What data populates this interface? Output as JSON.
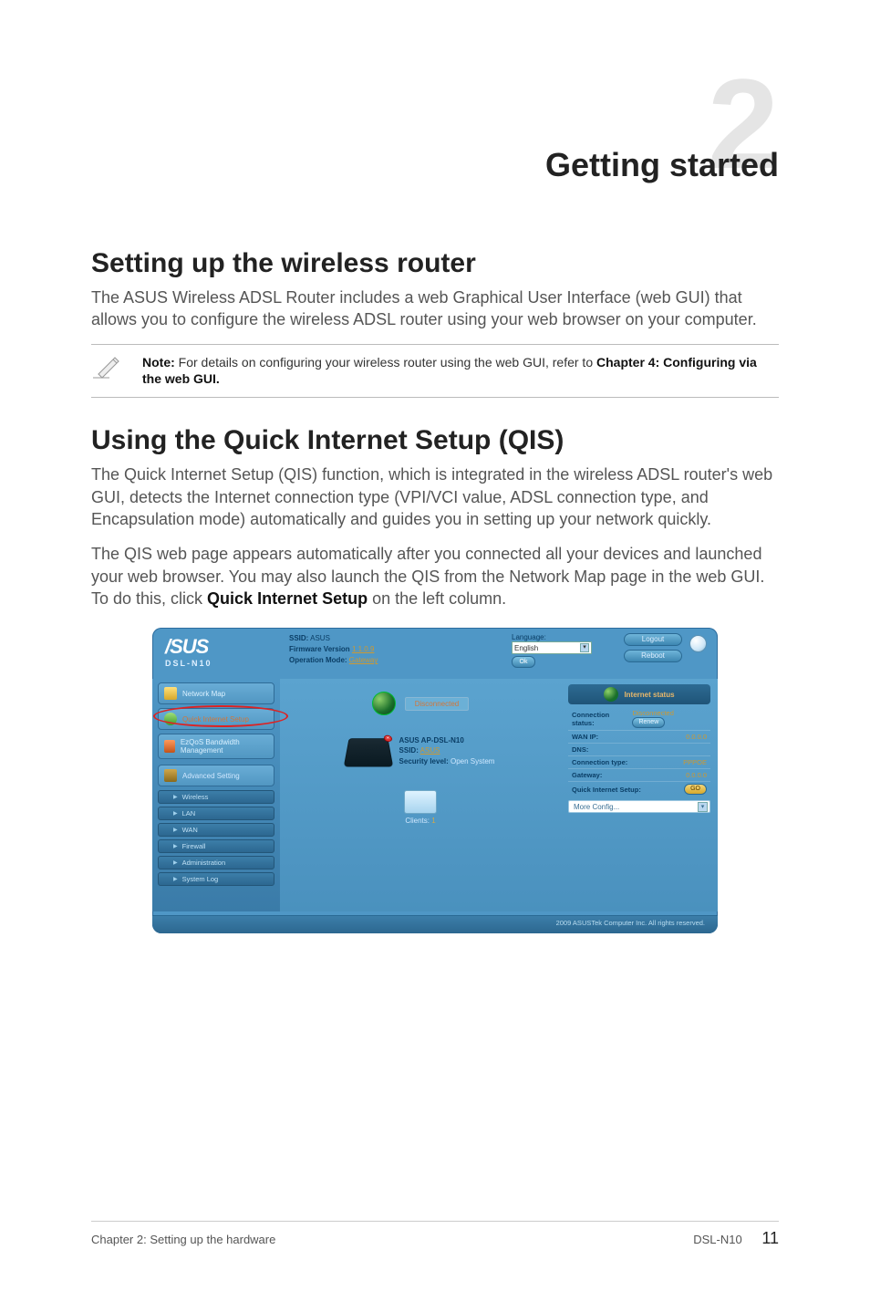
{
  "chapter": {
    "number": "2",
    "title": "Getting started"
  },
  "section1": {
    "heading": "Setting up the wireless router",
    "body": "The ASUS Wireless ADSL Router includes a web Graphical User Interface (web GUI) that allows you to configure the wireless ADSL router using your web browser on your computer."
  },
  "note": {
    "label": "Note:",
    "text": " For details on configuring your wireless router using the web GUI, refer to ",
    "bold_tail": "Chapter 4: Configuring via the web GUI."
  },
  "section2": {
    "heading": "Using the Quick Internet Setup (QIS)",
    "body1": "The Quick Internet Setup (QIS) function, which is integrated in the wireless ADSL router's web GUI, detects the Internet connection type (VPI/VCI value, ADSL connection type, and Encapsulation mode) automatically and guides you in setting up your network quickly.",
    "body2_a": "The QIS web page appears automatically after you connected all your devices and launched your web browser. You may also launch the QIS from the Network Map page in the web GUI. To do this, click ",
    "body2_bold": "Quick Internet Setup",
    "body2_b": " on the left column."
  },
  "gui": {
    "brand": "/SUS",
    "model": "DSL-N10",
    "header": {
      "ssid_label": "SSID:",
      "ssid_value": "ASUS",
      "fw_label": "Firmware Version",
      "fw_value": "1.1.0.9",
      "op_label": "Operation Mode:",
      "op_value": "Gateway",
      "lang_label": "Language:",
      "lang_value": "English",
      "ok": "Ok",
      "logout": "Logout",
      "reboot": "Reboot"
    },
    "sidebar": {
      "network_map": "Network Map",
      "qis": "Quick Internet Setup",
      "ezqos": "EzQoS Bandwidth Management",
      "advanced": "Advanced Setting",
      "items": [
        {
          "label": "Wireless"
        },
        {
          "label": "LAN"
        },
        {
          "label": "WAN"
        },
        {
          "label": "Firewall"
        },
        {
          "label": "Administration"
        },
        {
          "label": "System Log"
        }
      ]
    },
    "center": {
      "disconnected": "Disconnected",
      "router_name": "ASUS AP-DSL-N10",
      "ssid_label": "SSID:",
      "ssid_value": "ASUS",
      "sec_label": "Security level:",
      "sec_value": " Open System",
      "clients_label": "Clients:",
      "clients_value": " 1"
    },
    "status_panel": {
      "title": "Internet status",
      "rows": {
        "conn_status_k": "Connection status:",
        "conn_status_v": "Disconnected",
        "renew": "Renew",
        "wan_ip_k": "WAN IP:",
        "wan_ip_v": "0.0.0.0",
        "dns_k": "DNS:",
        "dns_v": "",
        "conn_type_k": "Connection type:",
        "conn_type_v": "PPPOE",
        "gateway_k": "Gateway:",
        "gateway_v": "0.0.0.0",
        "qis_k": "Quick Internet Setup:",
        "go": "GO"
      },
      "more_config": "More Config..."
    },
    "footer": "2009 ASUSTek Computer Inc. All rights reserved."
  },
  "page_footer": {
    "left": "Chapter 2: Setting up the hardware",
    "right_model": "DSL-N10",
    "page": "11"
  }
}
